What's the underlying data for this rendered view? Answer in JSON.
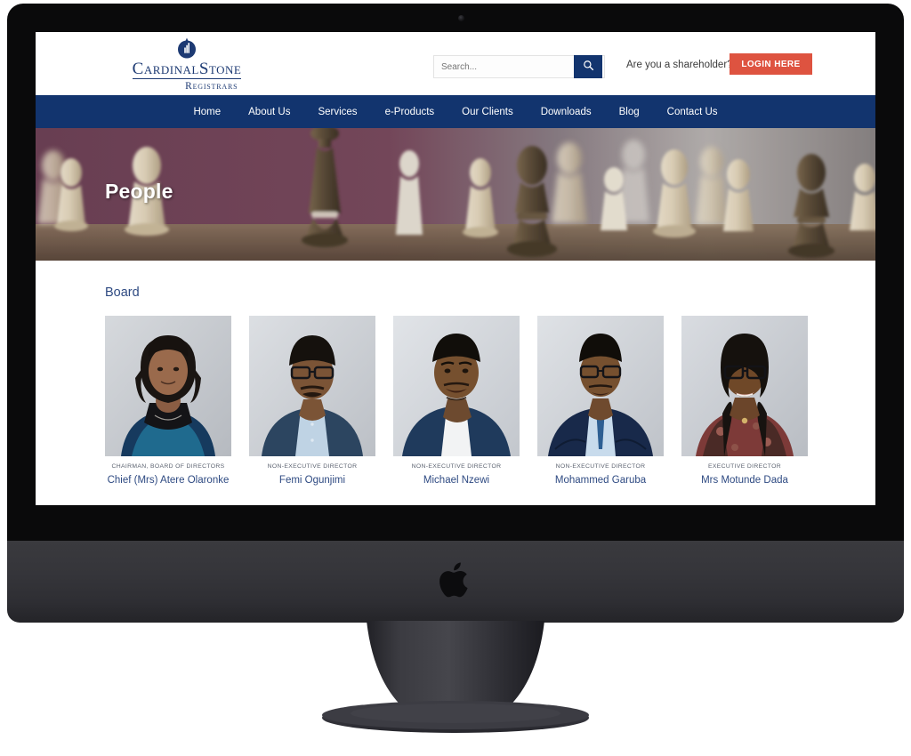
{
  "device": {
    "kind": "imac-desktop-monitor",
    "brand_logo": "apple-logo",
    "camera": "webcam-dot"
  },
  "site": {
    "logo": {
      "mark": "droplet-bar-chart-icon",
      "main_text": "CardinalStone",
      "sub_text": "Registrars"
    },
    "search": {
      "placeholder": "Search...",
      "value": "",
      "button_icon": "search-icon"
    },
    "shareholder_prompt": "Are you a shareholder?",
    "login_label": "LOGIN HERE",
    "nav": [
      {
        "label": "Home"
      },
      {
        "label": "About Us"
      },
      {
        "label": "Services"
      },
      {
        "label": "e-Products"
      },
      {
        "label": "Our Clients"
      },
      {
        "label": "Downloads"
      },
      {
        "label": "Blog"
      },
      {
        "label": "Contact Us"
      }
    ]
  },
  "hero": {
    "title": "People",
    "image_description": "chess-pieces-photo"
  },
  "main": {
    "section_title": "Board",
    "members": [
      {
        "role": "Chairman, Board of Directors",
        "name": "Chief (Mrs) Atere Olaronke",
        "photo": "portrait-woman-blue-patterned-jacket"
      },
      {
        "role": "Non-Executive Director",
        "name": "Femi Ogunjimi",
        "photo": "portrait-man-glasses-blue-blazer"
      },
      {
        "role": "Non-Executive Director",
        "name": "Michael Nzewi",
        "photo": "portrait-man-navy-blazer-white-shirt"
      },
      {
        "role": "Non-Executive Director",
        "name": "Mohammed Garuba",
        "photo": "portrait-man-glasses-navy-suit-tie"
      },
      {
        "role": "Executive Director",
        "name": "Mrs Motunde Dada",
        "photo": "portrait-woman-glasses-floral-jacket"
      }
    ]
  },
  "colors": {
    "navy": "#12346e",
    "accent_red": "#de5340",
    "link_blue": "#2e4a82",
    "hero_backdrop": "#6d4356"
  }
}
